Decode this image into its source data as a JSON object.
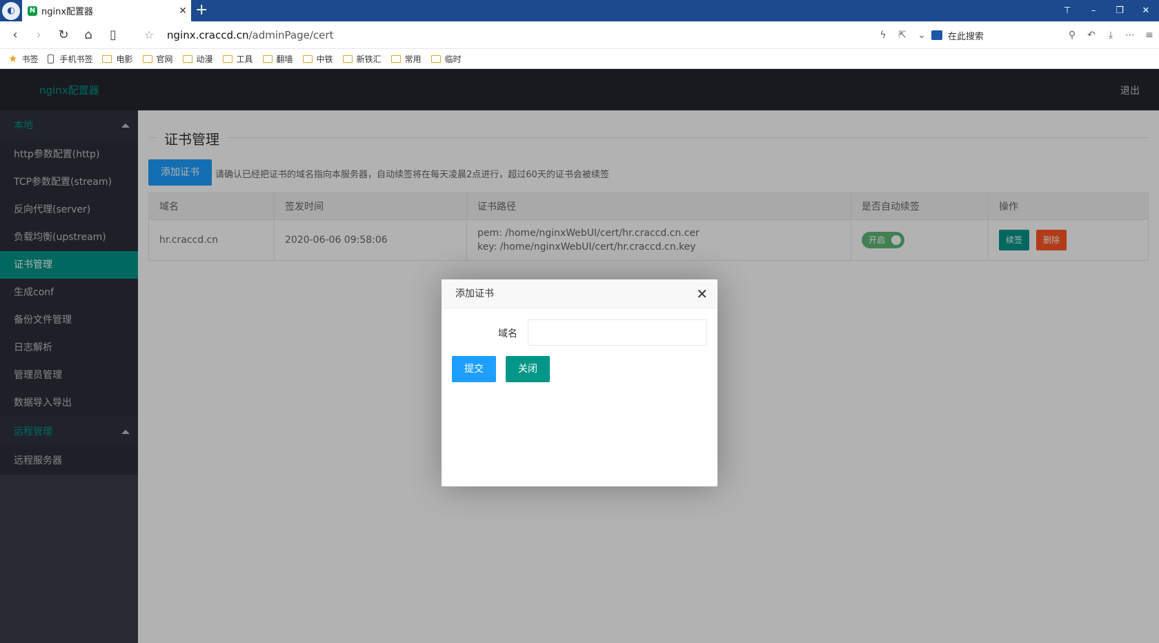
{
  "browser": {
    "tab_title": "nginx配置器",
    "tab_favicon_letter": "N",
    "url_host": "nginx.craccd.cn",
    "url_path": "/adminPage/cert",
    "search_placeholder": "在此搜索",
    "bookmarks": [
      "书签",
      "手机书签",
      "电影",
      "官网",
      "动漫",
      "工具",
      "翻墙",
      "中铁",
      "新铁汇",
      "常用",
      "临时"
    ]
  },
  "app": {
    "logo": "nginx配置器",
    "logout": "退出"
  },
  "sidebar": {
    "group1": "本地",
    "items": [
      "http参数配置(http)",
      "TCP参数配置(stream)",
      "反向代理(server)",
      "负载均衡(upstream)",
      "证书管理",
      "生成conf",
      "备份文件管理",
      "日志解析",
      "管理员管理",
      "数据导入导出"
    ],
    "active_index": 4,
    "group2": "远程管理",
    "items2": [
      "远程服务器"
    ]
  },
  "main": {
    "title": "证书管理",
    "add_button": "添加证书",
    "hint": "请确认已经把证书的域名指向本服务器，自动续签将在每天凌晨2点进行，超过60天的证书会被续签",
    "table": {
      "headers": [
        "域名",
        "签发时间",
        "证书路径",
        "是否自动续签",
        "操作"
      ],
      "rows": [
        {
          "domain": "hr.craccd.cn",
          "issued": "2020-06-06 09:58:06",
          "pem": "pem: /home/nginxWebUI/cert/hr.craccd.cn.cer",
          "key": "key: /home/nginxWebUI/cert/hr.craccd.cn.key",
          "auto_renew": "开启",
          "renew_button": "续签",
          "delete_button": "删除"
        }
      ]
    }
  },
  "modal": {
    "title": "添加证书",
    "field_label": "域名",
    "field_value": "",
    "submit_button": "提交",
    "close_button": "关闭"
  },
  "colors": {
    "accent": "#009688",
    "primary": "#1e9fff",
    "danger": "#ff5722",
    "switch_on": "#5fb878",
    "header_bg": "#23262e",
    "sidebar_bg": "#393d49"
  }
}
